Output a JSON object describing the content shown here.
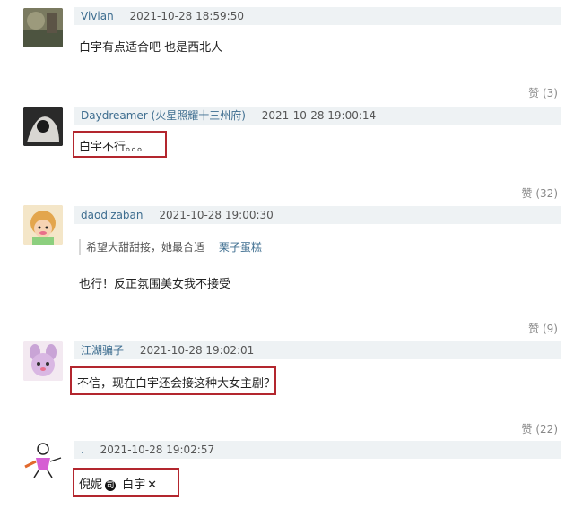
{
  "comments": [
    {
      "username": "Vivian",
      "time": "2021-10-28 18:59:50",
      "text": "白宇有点适合吧 也是西北人",
      "likes": "赞 (3)",
      "avatar_icon": "avatar-photo-icon"
    },
    {
      "username": "Daydreamer (火星照耀十三州府)",
      "time": "2021-10-28 19:00:14",
      "text": "白宇不行。。。",
      "likes": "赞 (32)",
      "avatar_icon": "avatar-photo-icon"
    },
    {
      "username": "daodizaban",
      "time": "2021-10-28 19:00:30",
      "quote_text": "希望大甜甜接，她最合适",
      "quote_author": "栗子蛋糕",
      "text": "也行！反正氛围美女我不接受",
      "likes": "赞 (9)",
      "avatar_icon": "avatar-cartoon-icon"
    },
    {
      "username": "江湖骗子",
      "time": "2021-10-28 19:02:01",
      "text": "不信，现在白宇还会接这种大女主剧？",
      "likes": "赞 (22)",
      "avatar_icon": "avatar-cartoon-icon"
    },
    {
      "username": ".",
      "time": "2021-10-28 19:02:57",
      "text_pre": "倪妮",
      "badge": "司",
      "text_post": " 白宇",
      "cross": "✕",
      "avatar_icon": "avatar-stickman-icon"
    }
  ],
  "colors": {
    "username": "#3d6d8f",
    "header_bg": "#eef2f4",
    "highlight_box": "#b3262e"
  }
}
